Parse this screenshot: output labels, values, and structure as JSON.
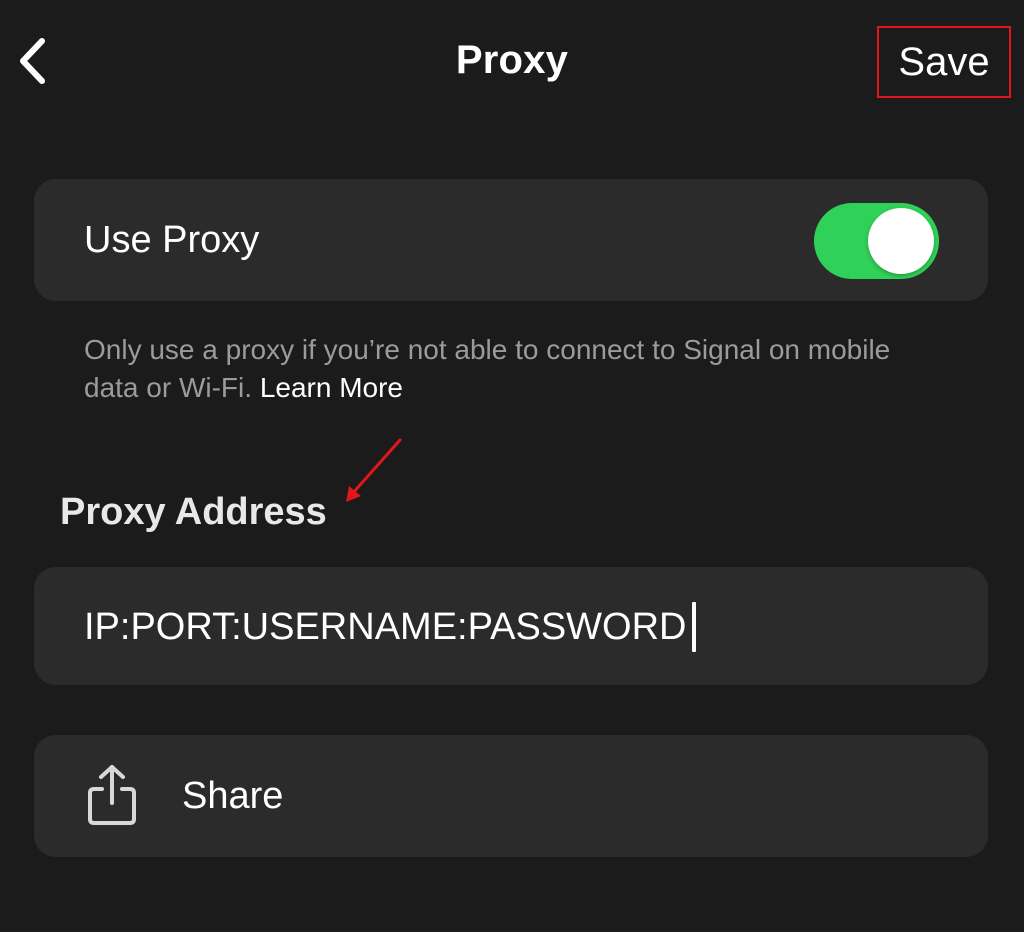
{
  "nav": {
    "title": "Proxy",
    "back_icon": "chevron-left-icon",
    "save_label": "Save"
  },
  "use_proxy": {
    "label": "Use Proxy",
    "enabled": true,
    "toggle_color": "#30d158"
  },
  "helper": {
    "text": "Only use a proxy if you’re not able to connect to Signal on mobile data or Wi-Fi.",
    "link_label": "Learn More"
  },
  "proxy_address": {
    "header": "Proxy Address",
    "value": "IP:PORT:USERNAME:PASSWORD"
  },
  "share": {
    "label": "Share",
    "icon": "share-icon"
  },
  "annotations": {
    "highlight_color": "#e0161b"
  }
}
